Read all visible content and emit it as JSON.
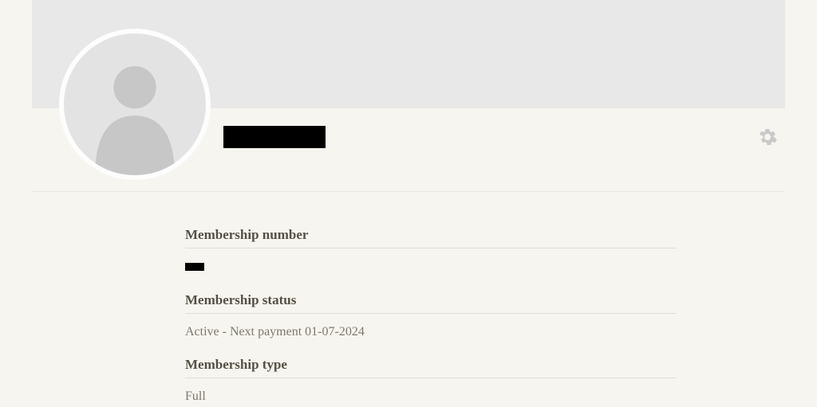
{
  "profile": {
    "name": "",
    "avatar_icon": "person-silhouette"
  },
  "details": {
    "membership_number": {
      "label": "Membership number",
      "value": ""
    },
    "membership_status": {
      "label": "Membership status",
      "value": "Active - Next payment 01-07-2024"
    },
    "membership_type": {
      "label": "Membership type",
      "value": "Full"
    }
  },
  "icons": {
    "settings": "gear-icon"
  },
  "colors": {
    "page_bg": "#f7f5ef",
    "cover_bg": "#e8e8e8",
    "avatar_bg": "#e3e3e3",
    "text_label": "#555046",
    "text_value": "#7d786e"
  }
}
